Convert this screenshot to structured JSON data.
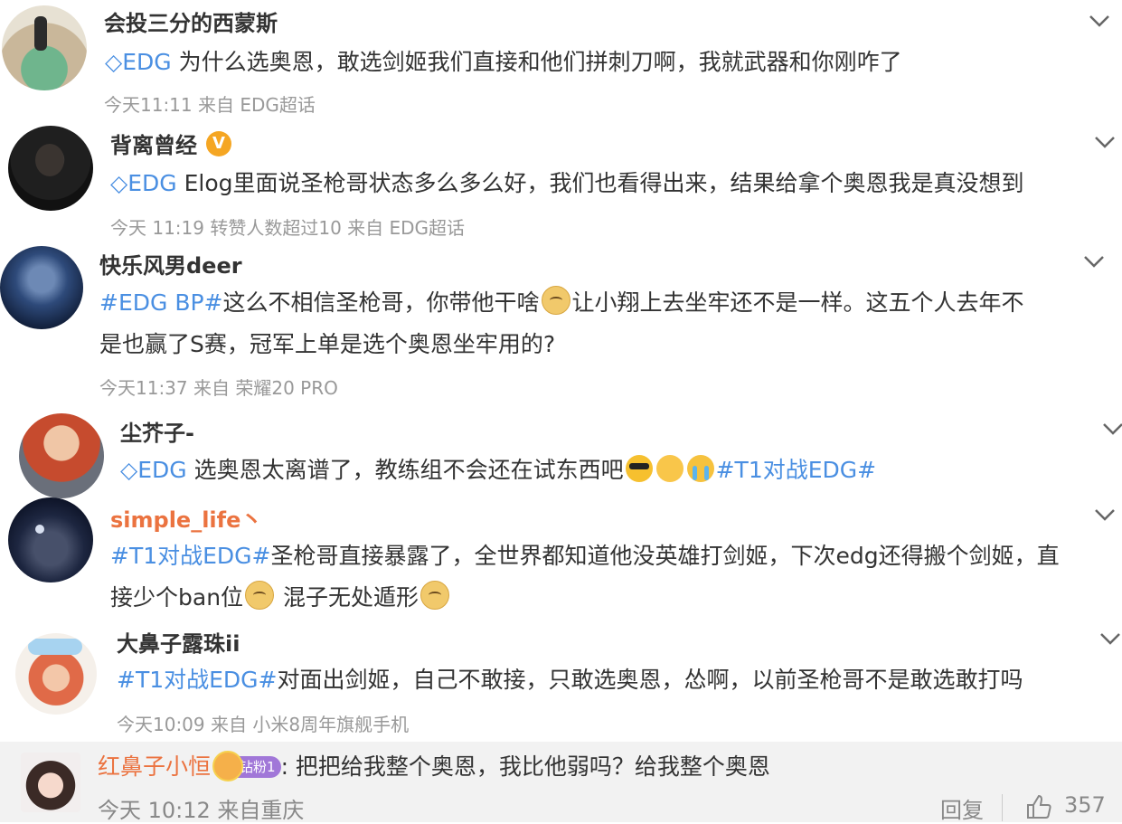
{
  "comments": [
    {
      "name": "会投三分的西蒙斯",
      "tag": "EDG",
      "text": " 为什么选奥恩，敢选剑姬我们直接和他们拼刺刀啊，我就武器和你刚咋了",
      "meta": "今天11:11  来自 EDG超话"
    },
    {
      "name": "背离曾经",
      "tag": "EDG",
      "text": " Elog里面说圣枪哥状态多么多么好，我们也看得出来，结果给拿个奥恩我是真没想到",
      "meta": "今天 11:19 转赞人数超过10  来自 EDG超话"
    },
    {
      "name": "快乐风男deer",
      "hashtag": "#EDG BP#",
      "text1": "这么不相信圣枪哥，你带他干啥",
      "text2": "让小翔上去坐牢还不是一样。这五个人去年不",
      "text3": "是也赢了S赛，冠军上单是选个奥恩坐牢用的?",
      "meta": "今天11:37  来自 荣耀20 PRO"
    },
    {
      "name": "尘芥子-",
      "tag": "EDG",
      "text": " 选奥恩太离谱了，教练组不会还在试东西吧",
      "hashtag": "#T1对战EDG#"
    },
    {
      "name": "simple_life丶",
      "hashtag": "#T1对战EDG#",
      "text1": "圣枪哥直接暴露了，全世界都知道他没英雄打剑姬，下次edg还得搬个剑姬，直",
      "text2": "接少个ban位",
      "text3": " 混子无处遁形"
    },
    {
      "name": "大鼻子露珠ii",
      "hashtag": "#T1对战EDG#",
      "text": "对面出剑姬，自己不敢接，只敢选奥恩，怂啊，以前圣枪哥不是敢选敢打吗",
      "meta": "今天10:09  来自 小米8周年旗舰手机"
    }
  ],
  "reply": {
    "name": "红鼻子小恒",
    "badge": "钻粉1",
    "text": ":  把把给我整个奥恩，我比他弱吗？给我整个奥恩",
    "meta": "今天 10:12 来自重庆",
    "reply_label": "回复",
    "like_count": "357"
  },
  "colors": {
    "link": "#4a8fe2",
    "meta": "#999999",
    "orange_name": "#eb7340",
    "reply_name": "#eb7340"
  }
}
